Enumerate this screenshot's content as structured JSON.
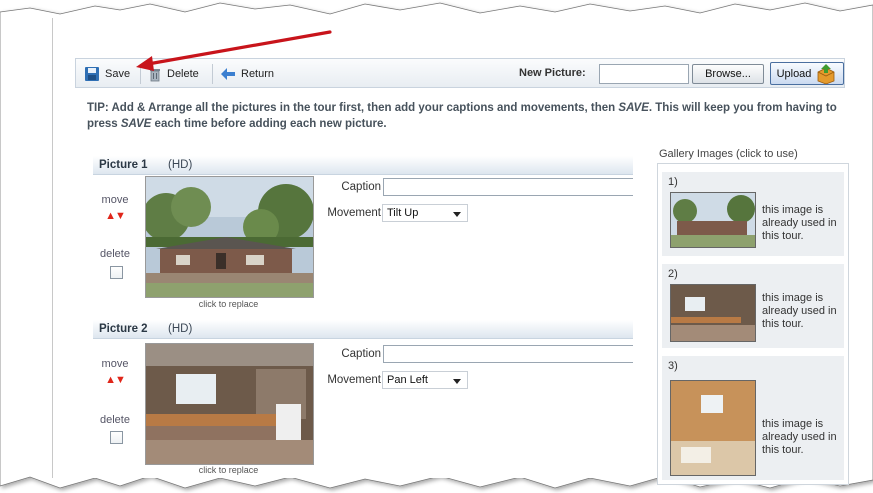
{
  "toolbar": {
    "save_label": "Save",
    "delete_label": "Delete",
    "return_label": "Return",
    "new_picture_label": "New Picture:",
    "browse_label": "Browse...",
    "upload_label": "Upload"
  },
  "tip": {
    "part1": "TIP: Add & Arrange all the pictures in the tour first, then add your captions and movements, then ",
    "save1": "SAVE",
    "part2": ". This will keep you from having to press ",
    "save2": "SAVE",
    "part3": " each time before adding each new picture."
  },
  "pictures": [
    {
      "title": "Picture 1",
      "hd": "(HD)",
      "move_label": "move",
      "arrows": "▲▼",
      "delete_label": "delete",
      "replace_label": "click to replace",
      "caption_label": "Caption",
      "caption_value": "",
      "movement_label": "Movement",
      "movement_value": "Tilt Up",
      "photo_icon": "house-exterior-photo"
    },
    {
      "title": "Picture 2",
      "hd": "(HD)",
      "move_label": "move",
      "arrows": "▲▼",
      "delete_label": "delete",
      "replace_label": "click to replace",
      "caption_label": "Caption",
      "caption_value": "",
      "movement_label": "Movement",
      "movement_value": "Pan Left",
      "photo_icon": "kitchen-interior-photo"
    }
  ],
  "gallery": {
    "title": "Gallery Images (click to use)",
    "items": [
      {
        "num": "1)",
        "text": "this image is already used in this tour."
      },
      {
        "num": "2)",
        "text": "this image is already used in this tour."
      },
      {
        "num": "3)",
        "text": "this image is already used in this tour."
      }
    ]
  },
  "colors": {
    "annotation_arrow": "#c8141b",
    "tip_text": "#47525c",
    "move_arrows": "#e0261a"
  }
}
